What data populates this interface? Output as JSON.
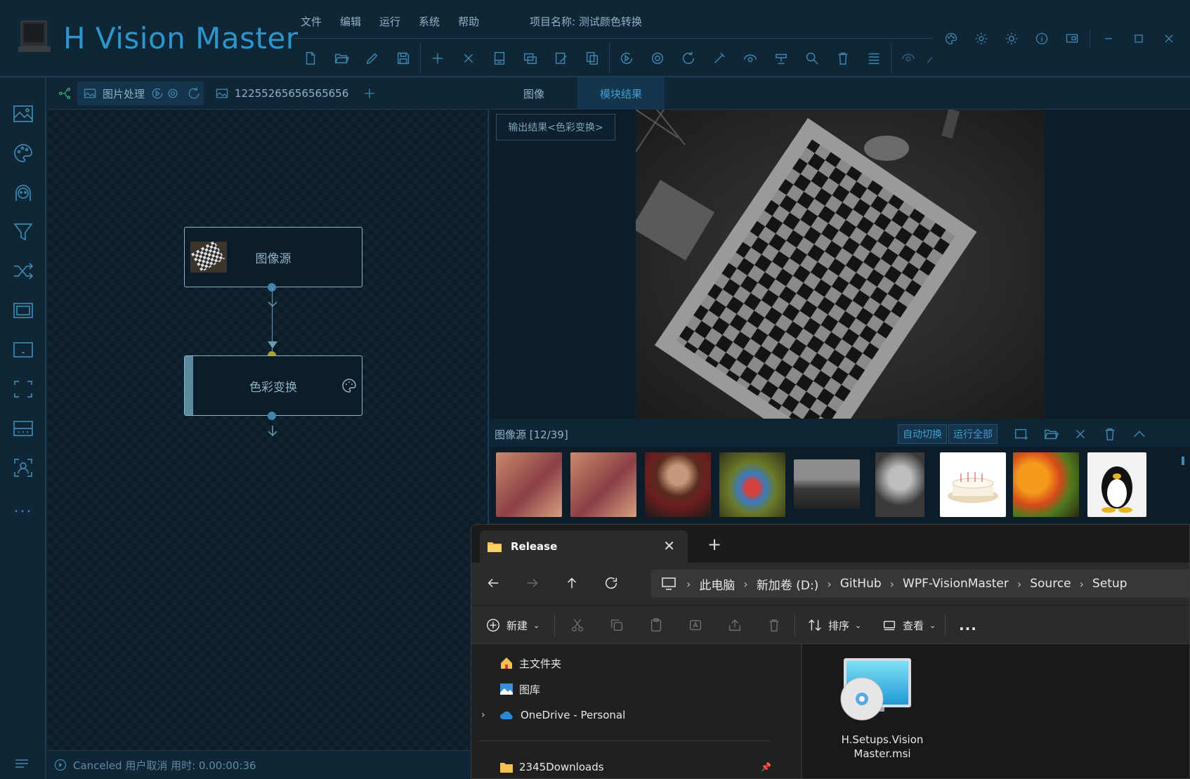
{
  "app": {
    "title": "H Vision Master",
    "menu": [
      "文件",
      "编辑",
      "运行",
      "系统",
      "帮助"
    ],
    "project_label": "项目名称:  测试颜色转换",
    "toolbar_icons": [
      "new-file-icon",
      "open-folder-icon",
      "edit-icon",
      "save-icon",
      "add-icon",
      "delete-icon",
      "module-icon",
      "window-icon",
      "edit-module-icon",
      "copy-icon",
      "run-once-icon",
      "record-icon",
      "loop-icon",
      "tool-icon",
      "view-icon",
      "settings-module-icon",
      "search-icon",
      "trash-icon",
      "list-icon",
      "eye-icon",
      "pen-icon"
    ],
    "window_icons": [
      "palette-icon",
      "gear-icon",
      "theme-icon",
      "info-icon",
      "display-icon",
      "minimize-icon",
      "maximize-icon",
      "close-icon"
    ],
    "accent_color": "#2c95c9"
  },
  "sidebar": {
    "icons": [
      "image-icon",
      "palette-icon",
      "face-icon",
      "filter-icon",
      "shuffle-icon",
      "frame-icon",
      "panel-icon",
      "fullscreen-icon",
      "grid-icon",
      "person-scan-icon",
      "more-icon"
    ],
    "more_label": "..."
  },
  "flow": {
    "tabs": [
      {
        "label": "图片处理",
        "active": true
      },
      {
        "label": "12255265656565656",
        "active": false
      }
    ],
    "nodes": [
      {
        "label": "图像源",
        "icon": "checkerboard-thumb"
      },
      {
        "label": "色彩变换",
        "icon": "palette-icon"
      }
    ],
    "status": "Canceled 用户取消 用时: 0.00:00:36"
  },
  "result_panel": {
    "tabs": [
      "图像",
      "模块结果"
    ],
    "active_tab": "模块结果",
    "output_button": "输出结果<色彩变换>"
  },
  "image_source": {
    "label": "图像源 [12/39]",
    "auto_switch": "自动切换",
    "run_all": "运行全部",
    "thumbnails": [
      "lena-1",
      "lena-2",
      "woman-portrait",
      "mandrill",
      "landscape",
      "dog",
      "cake",
      "fruits",
      "penguin"
    ]
  },
  "explorer": {
    "tab_title": "Release",
    "breadcrumbs": [
      "此电脑",
      "新加卷 (D:)",
      "GitHub",
      "WPF-VisionMaster",
      "Source",
      "Setup"
    ],
    "commands": {
      "new": "新建",
      "sort": "排序",
      "view": "查看",
      "more": "..."
    },
    "nav_items": [
      "主文件夹",
      "图库",
      "OneDrive - Personal",
      "2345Downloads"
    ],
    "file": {
      "name": "H.Setups.Vision Master.msi"
    }
  }
}
